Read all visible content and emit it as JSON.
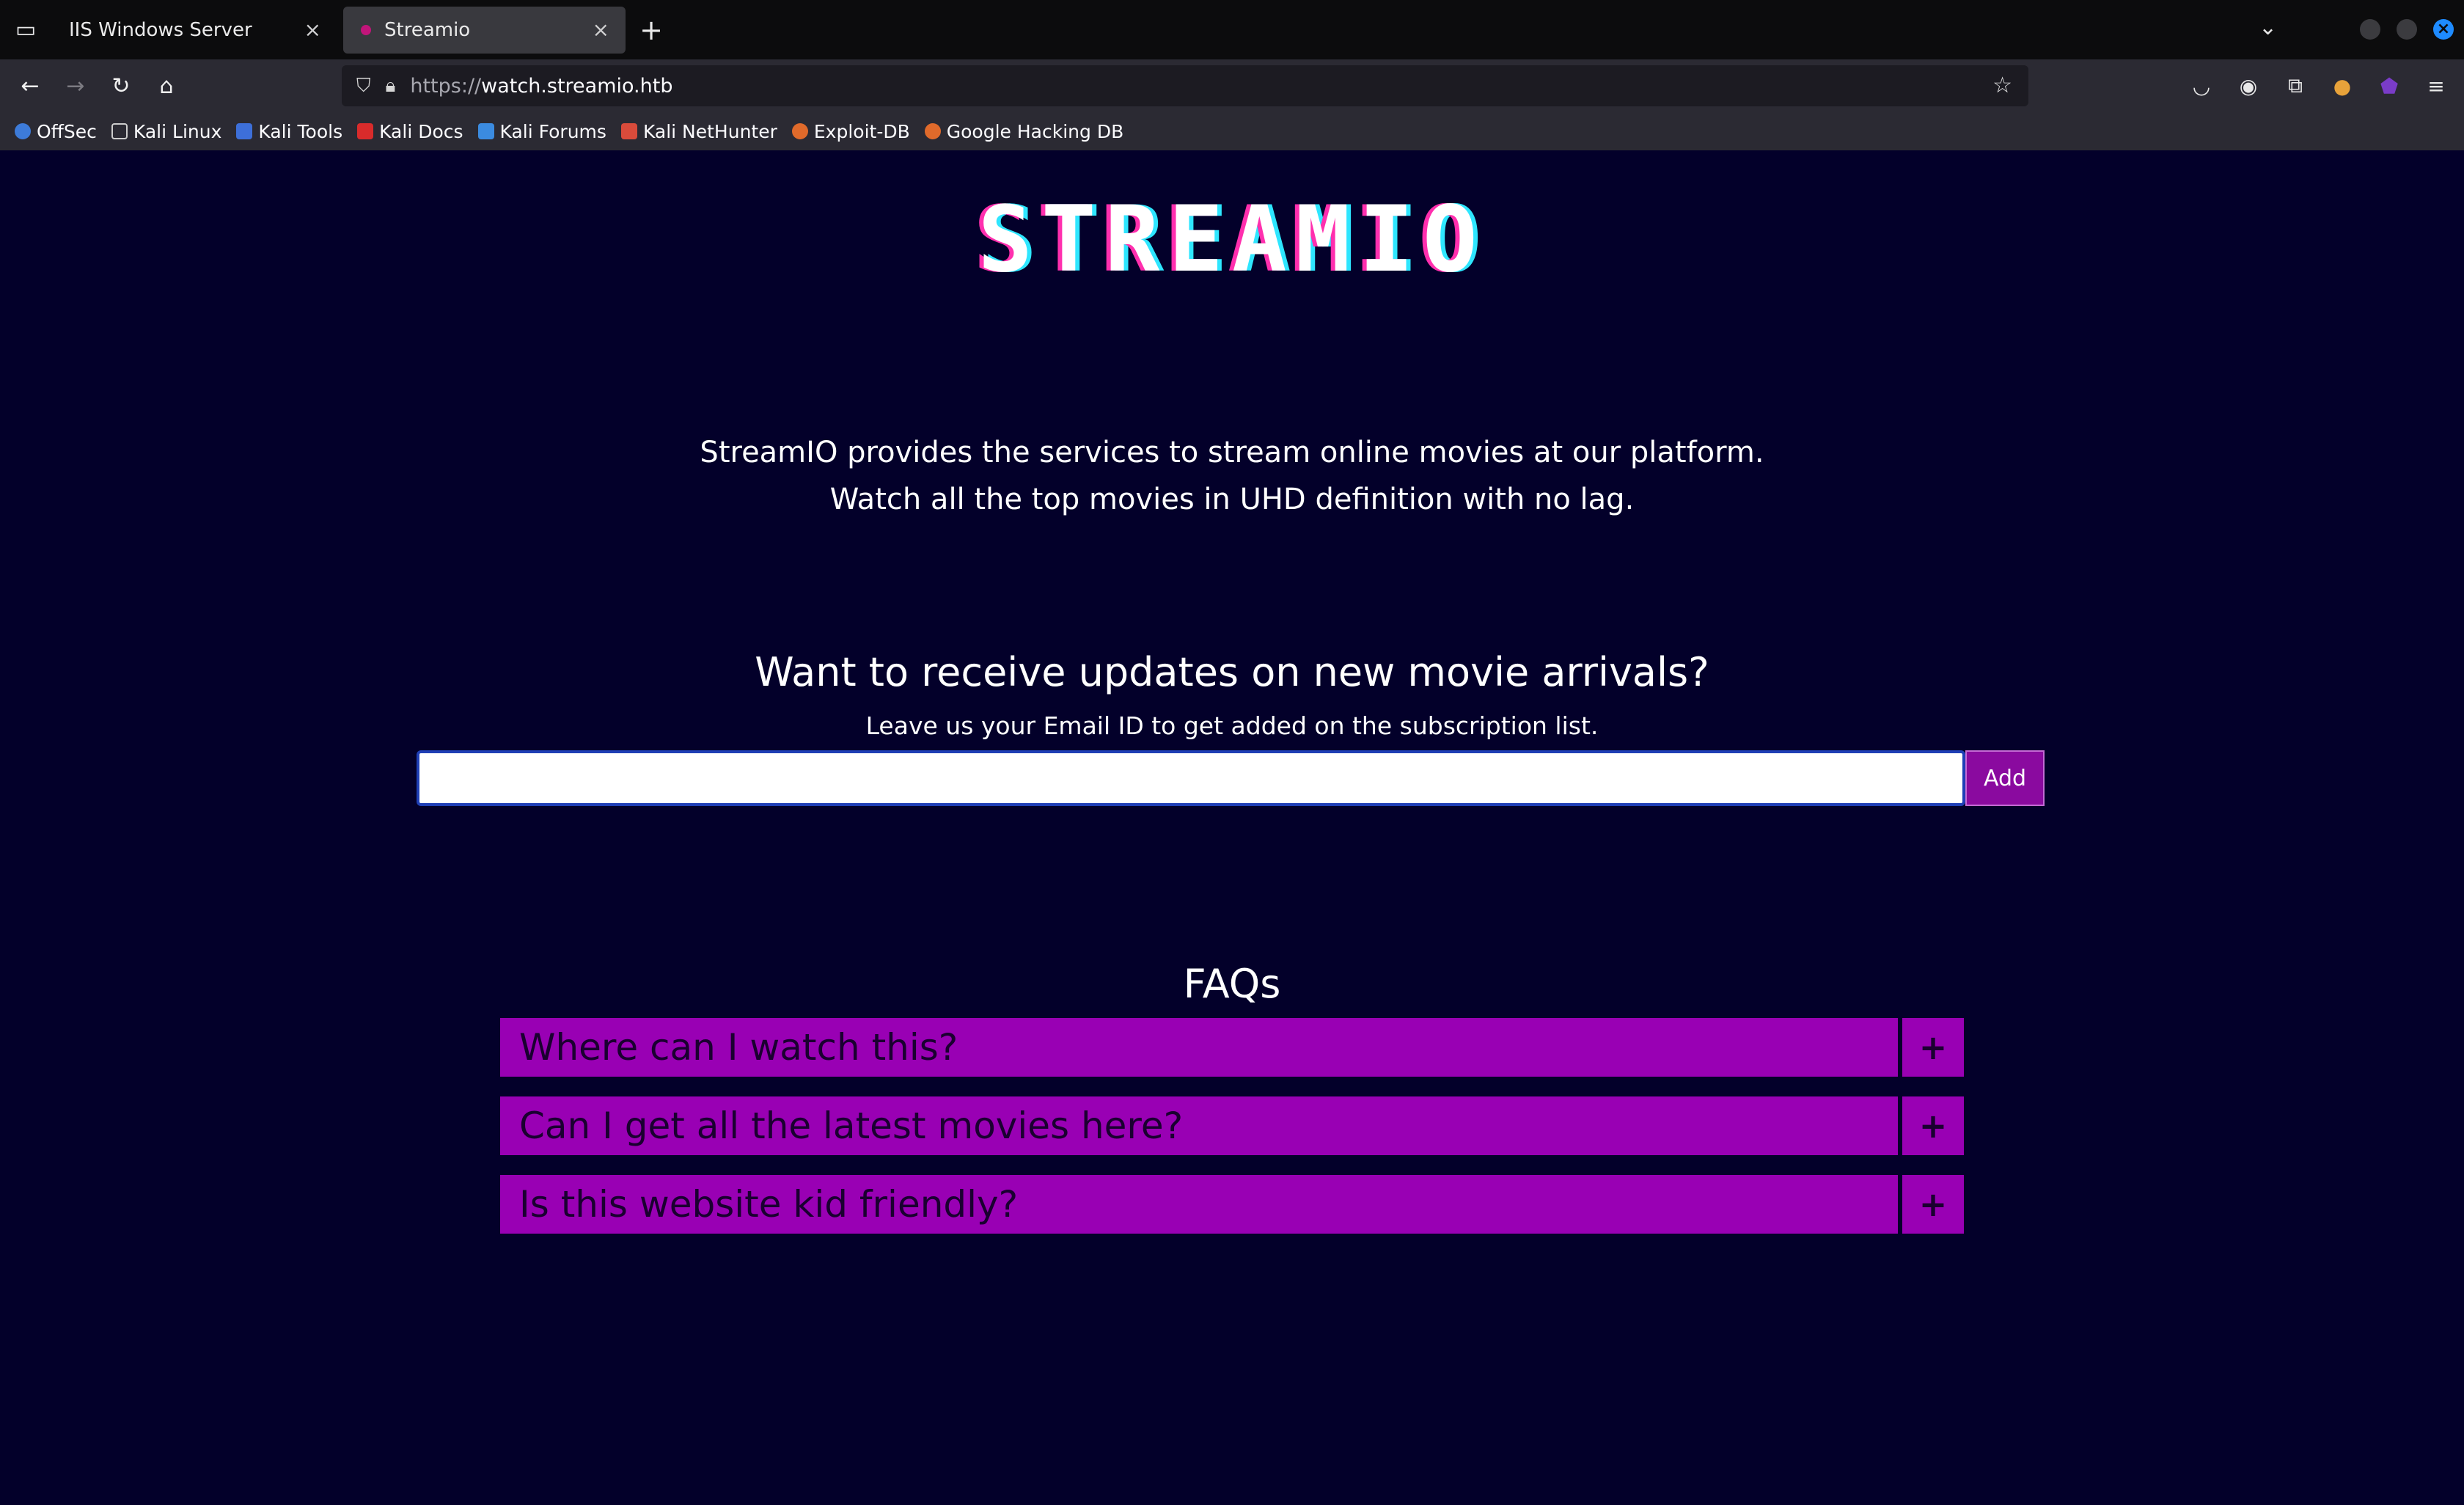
{
  "tabs": [
    {
      "label": "IIS Windows Server",
      "active": false
    },
    {
      "label": "Streamio",
      "active": true
    }
  ],
  "icons": {
    "tab_list": "tab-list-icon",
    "close": "close-icon",
    "new_tab": "plus-icon",
    "back": "back-arrow-icon",
    "forward": "forward-arrow-icon",
    "reload": "reload-icon",
    "home": "home-icon"
  },
  "address": {
    "protocol": "https://",
    "host": "watch.streamio.htb"
  },
  "bookmarks": [
    {
      "label": "OffSec",
      "color": "#3d7bd9"
    },
    {
      "label": "Kali Linux",
      "color": "#2b2a33"
    },
    {
      "label": "Kali Tools",
      "color": "#3d6fd9"
    },
    {
      "label": "Kali Docs",
      "color": "#d92b2b"
    },
    {
      "label": "Kali Forums",
      "color": "#3b8be0"
    },
    {
      "label": "Kali NetHunter",
      "color": "#d94b3b"
    },
    {
      "label": "Exploit-DB",
      "color": "#e06a2b"
    },
    {
      "label": "Google Hacking DB",
      "color": "#e06a2b"
    }
  ],
  "page": {
    "logo": "STREAMIO",
    "intro_line1": "StreamIO provides the services to stream online movies at our platform.",
    "intro_line2": "Watch all the top movies in UHD definition with no lag.",
    "subscribe_heading": "Want to receive updates on new movie arrivals?",
    "subscribe_sub": "Leave us your Email ID to get added on the subscription list.",
    "email_value": "",
    "add_label": "Add",
    "faq_title": "FAQs",
    "faqs": [
      {
        "question": "Where can I watch this?",
        "toggle": "+"
      },
      {
        "question": "Can I get all the latest movies here?",
        "toggle": "+"
      },
      {
        "question": "Is this website kid friendly?",
        "toggle": "+"
      }
    ]
  },
  "colors": {
    "page_bg": "#03002a",
    "faq_bg": "#9900b4",
    "button_bg": "#8a0a9f"
  }
}
